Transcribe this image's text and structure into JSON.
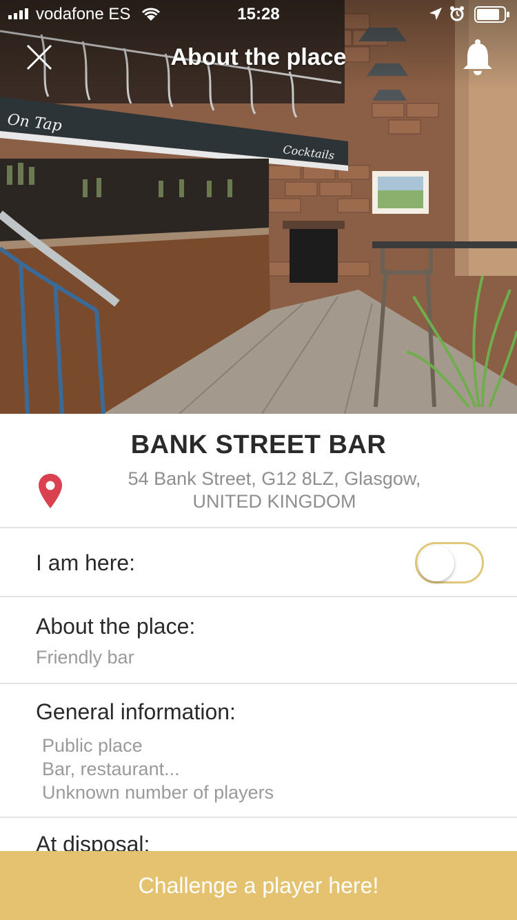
{
  "status_bar": {
    "carrier": "vodafone ES",
    "time": "15:28"
  },
  "nav": {
    "title": "About the place"
  },
  "place": {
    "name": "BANK STREET BAR",
    "address_line1": "54 Bank Street, G12 8LZ, Glasgow,",
    "address_line2": "UNITED KINGDOM"
  },
  "hero_photo": {
    "chalkboard_text": "On Tap",
    "cocktails_text": "Cocktails"
  },
  "rows": {
    "i_am_here": {
      "label": "I am here:",
      "toggle_on": false
    },
    "about": {
      "label": "About the place:",
      "value": "Friendly bar"
    },
    "general": {
      "label": "General information:",
      "items": [
        "Public place",
        "Bar, restaurant...",
        "Unknown number of players"
      ]
    },
    "disposal": {
      "label": "At disposal:"
    }
  },
  "cta": {
    "label": "Challenge a player here!"
  },
  "colors": {
    "accent_gold": "#e5c26f",
    "toggle_border": "#e1c77a",
    "pin_red": "#d94150",
    "muted_text": "#9a9a9a"
  }
}
